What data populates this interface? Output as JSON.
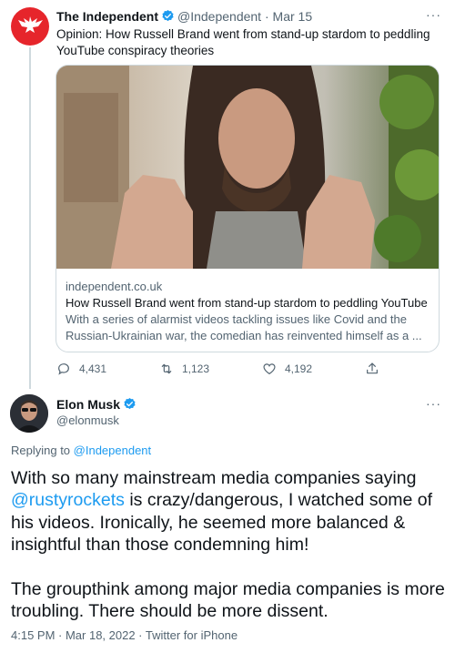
{
  "quoted_tweet": {
    "author_name": "The Independent",
    "handle": "@Independent",
    "date": "Mar 15",
    "text": "Opinion: How Russell Brand went from stand-up stardom to peddling YouTube conspiracy theories",
    "card": {
      "domain": "independent.co.uk",
      "title": "How Russell Brand went from stand-up stardom to peddling YouTube ...",
      "description": "With a series of alarmist videos tackling issues like Covid and the Russian-Ukrainian war, the comedian has reinvented himself as a ..."
    },
    "actions": {
      "replies": "4,431",
      "retweets": "1,123",
      "likes": "4,192"
    }
  },
  "tweet": {
    "author_name": "Elon Musk",
    "handle": "@elonmusk",
    "replying_prefix": "Replying to ",
    "replying_to": "@Independent",
    "body_p1_mention": "@rustyrockets",
    "body_p1_before": "With so many mainstream media companies saying ",
    "body_p1_after": " is crazy/dangerous, I watched some of his videos. Ironically, he seemed more balanced & insightful than those condemning him!",
    "body_p2": "The groupthink among major media companies is more troubling. There should be more dissent.",
    "timestamp": "4:15 PM · Mar 18, 2022 · Twitter for iPhone"
  },
  "more_label": "···",
  "colors": {
    "accent": "#1d9bf0",
    "independent_red": "#e6252b",
    "muted": "#536471"
  }
}
